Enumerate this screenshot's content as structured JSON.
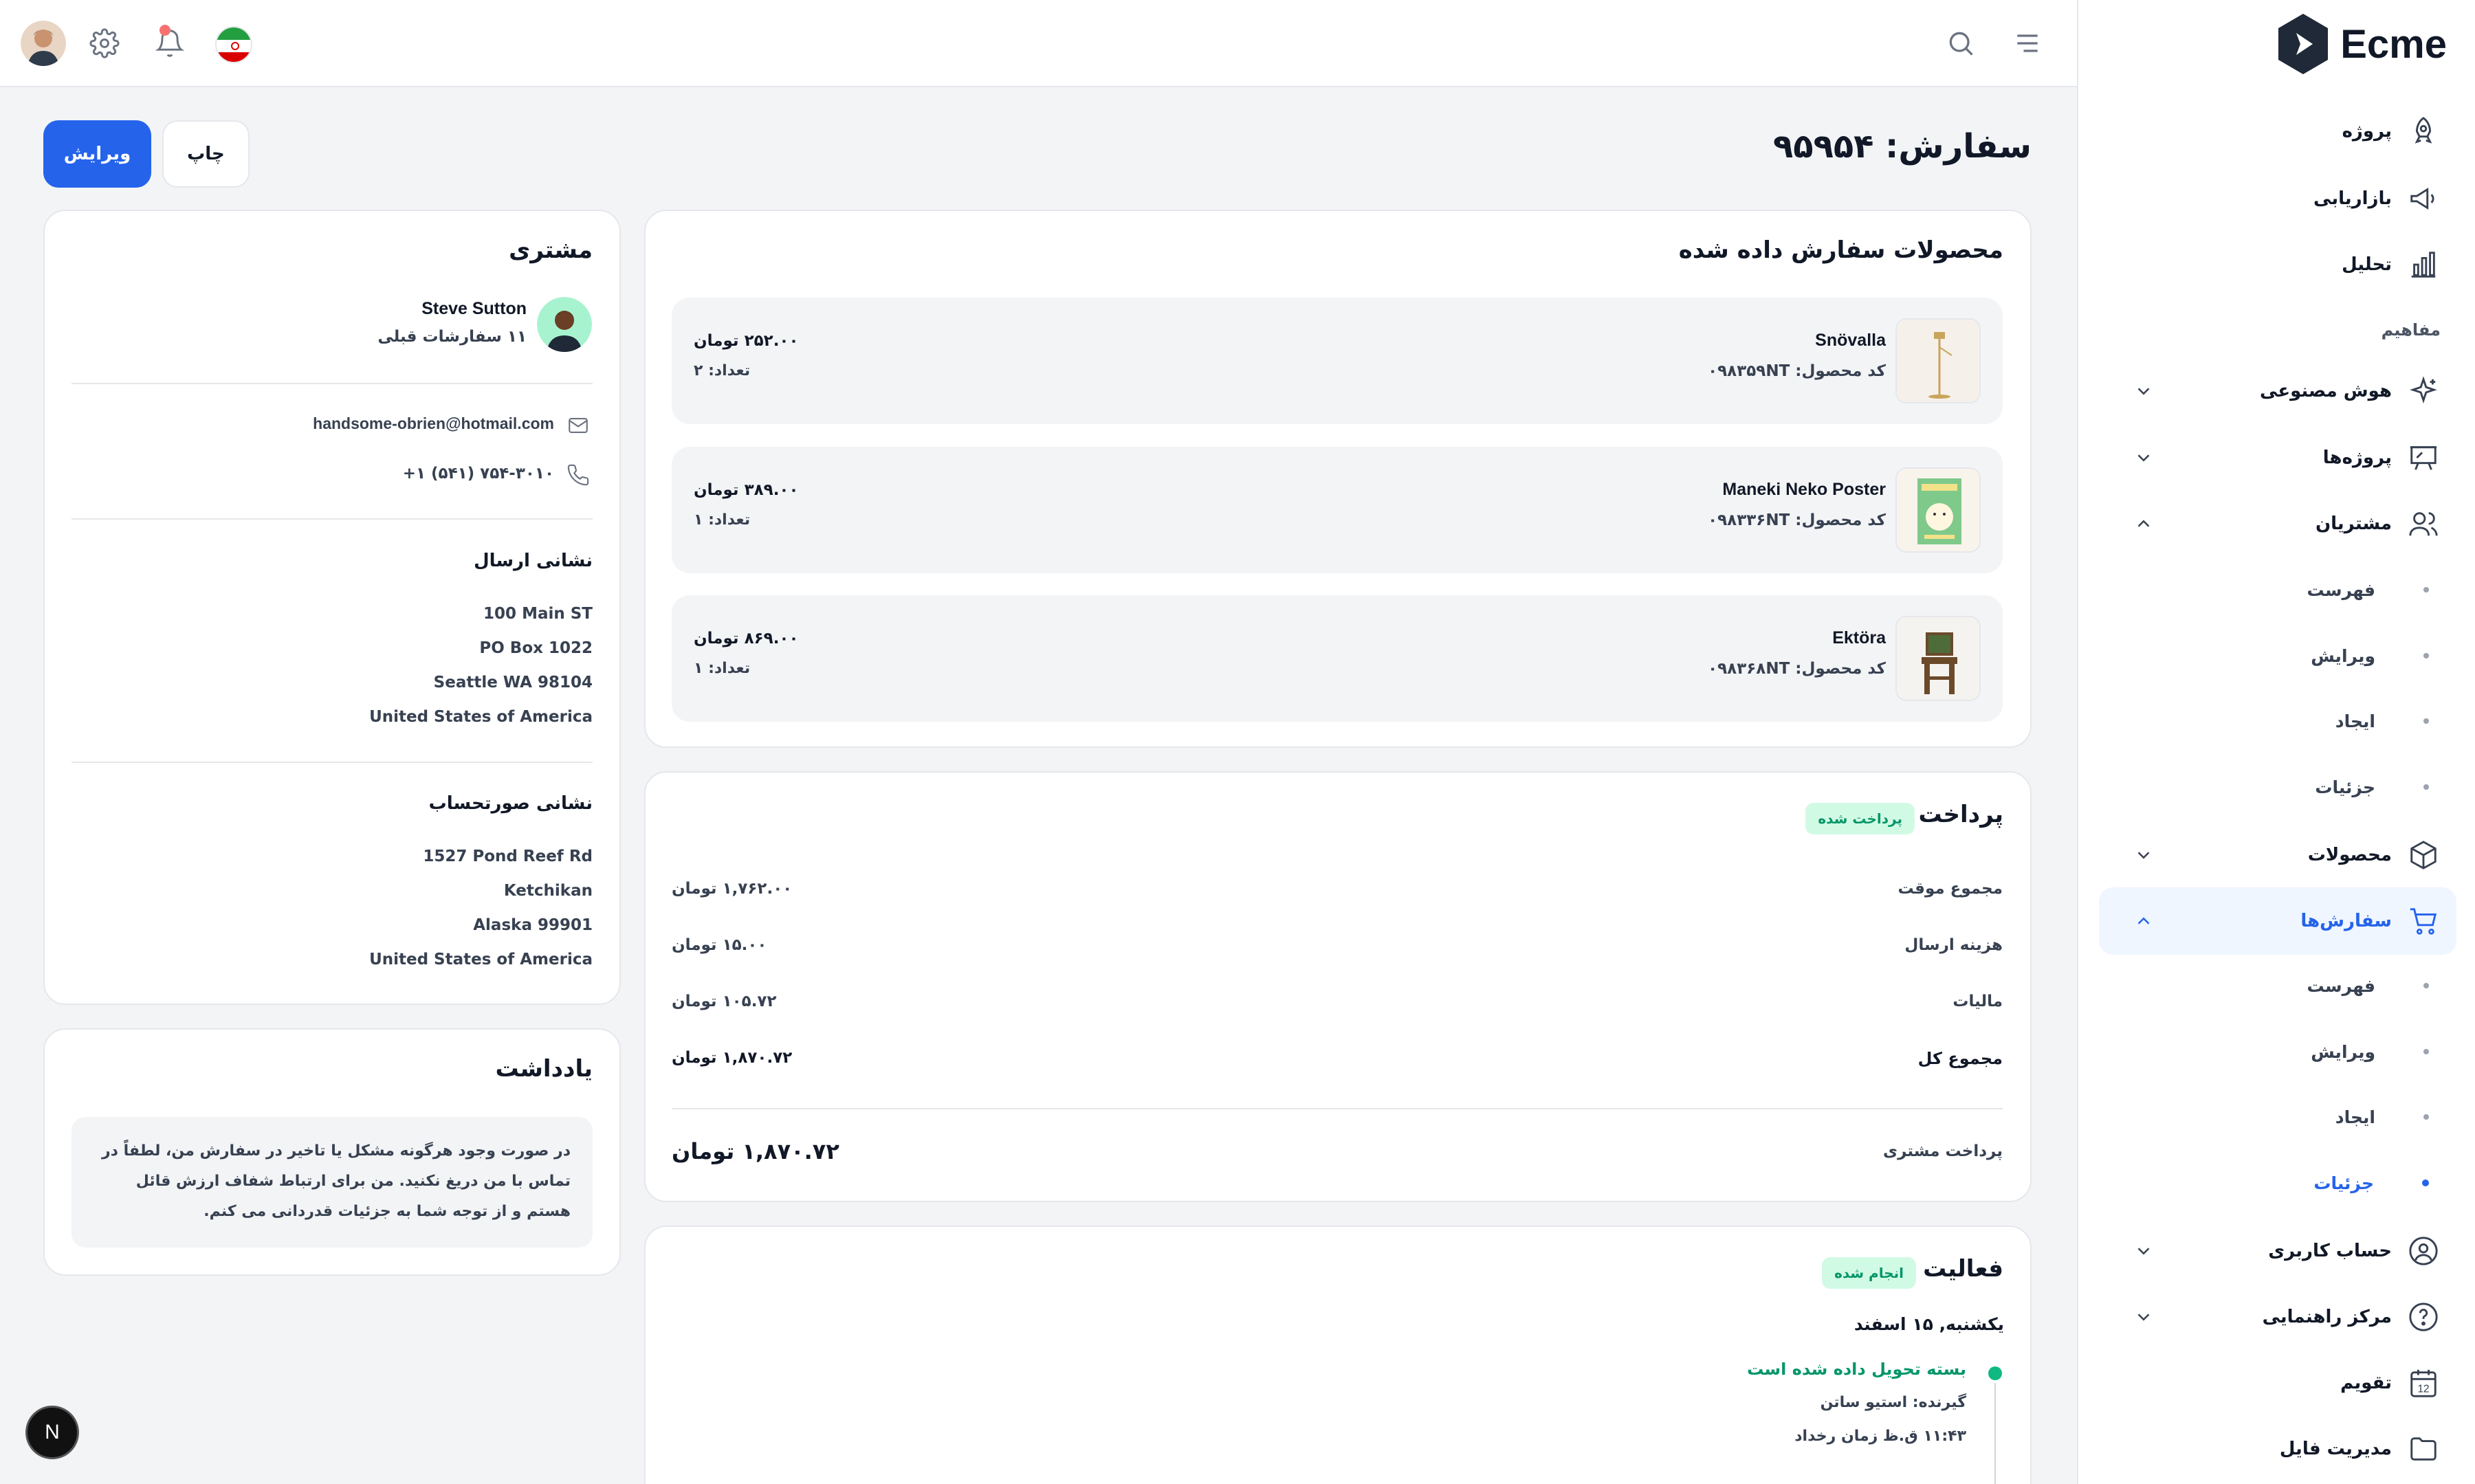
{
  "app": {
    "name": "Ecme"
  },
  "sidebar": {
    "items": [
      {
        "label": "پروژه",
        "icon": "rocket-icon"
      },
      {
        "label": "بازاریابی",
        "icon": "megaphone-icon"
      },
      {
        "label": "تحلیل",
        "icon": "chart-icon"
      }
    ],
    "section_title": "مفاهیم",
    "groups": [
      {
        "label": "هوش مصنوعی",
        "icon": "sparkle-icon"
      },
      {
        "label": "پروژه‌ها",
        "icon": "presentation-icon"
      },
      {
        "label": "مشتریان",
        "icon": "users-icon",
        "subitems": [
          "فهرست",
          "ویرایش",
          "ایجاد",
          "جزئیات"
        ]
      },
      {
        "label": "محصولات",
        "icon": "box-icon"
      },
      {
        "label": "سفارش‌ها",
        "icon": "cart-icon",
        "subitems": [
          "فهرست",
          "ویرایش",
          "ایجاد",
          "جزئیات"
        ]
      },
      {
        "label": "حساب کاربری",
        "icon": "user-circle-icon"
      },
      {
        "label": "مرکز راهنمایی",
        "icon": "help-icon"
      },
      {
        "label": "تقویم",
        "icon": "calendar-icon",
        "calendar_day": "12"
      },
      {
        "label": "مدیریت فایل",
        "icon": "folder-icon"
      }
    ]
  },
  "order": {
    "title": "سفارش: ۹۵۹۵۴",
    "edit_label": "ویرایش",
    "print_label": "چاپ"
  },
  "products": {
    "title": "محصولات سفارش داده شده",
    "items": [
      {
        "name": "Snövalla",
        "code": "کد محصول: ۰۹۸۳۵۹NT",
        "price": "۲۵۲.۰۰ تومان",
        "qty": "تعداد: ۲"
      },
      {
        "name": "Maneki Neko Poster",
        "code": "کد محصول: ۰۹۸۳۳۶NT",
        "price": "۳۸۹.۰۰ تومان",
        "qty": "تعداد: ۱"
      },
      {
        "name": "Ektöra",
        "code": "کد محصول: ۰۹۸۳۶۸NT",
        "price": "۸۶۹.۰۰ تومان",
        "qty": "تعداد: ۱"
      }
    ]
  },
  "payment": {
    "title": "پرداخت",
    "status": "پرداخت شده",
    "rows": [
      {
        "label": "مجموع موقت",
        "value": "۱,۷۶۲.۰۰ تومان"
      },
      {
        "label": "هزینه ارسال",
        "value": "۱۵.۰۰ تومان"
      },
      {
        "label": "مالیات",
        "value": "۱۰۵.۷۲ تومان"
      },
      {
        "label": "مجموع کل",
        "value": "۱,۸۷۰.۷۲ تومان"
      }
    ],
    "customer_paid_label": "پرداخت مشتری",
    "customer_paid_value": "۱,۸۷۰.۷۲ تومان"
  },
  "activity": {
    "title": "فعالیت",
    "status": "انجام شده",
    "date": "یکشنبه, ۱۵ اسفند",
    "event_title": "بسته تحویل داده شده است",
    "event_recipient": "گیرنده: استیو ساتن",
    "event_time": "۱۱:۴۳ ق.ظ زمان رخداد"
  },
  "customer": {
    "title": "مشتری",
    "name": "Steve Sutton",
    "orders": "۱۱ سفارشات قبلی",
    "email": "handsome-obrien@hotmail.com",
    "phone": "+۱ (۵۴۱) ۷۵۴-۳۰۱۰",
    "shipping_title": "نشانی ارسال",
    "shipping": [
      "100 Main ST",
      "PO Box 1022",
      "Seattle WA 98104",
      "United States of America"
    ],
    "billing_title": "نشانی صورتحساب",
    "billing": [
      "1527 Pond Reef Rd",
      "Ketchikan",
      "Alaska 99901",
      "United States of America"
    ]
  },
  "note": {
    "title": "یادداشت",
    "text": "در صورت وجود هرگونه مشکل یا تاخیر در سفارش من، لطفاً در تماس با من دریغ نکنید. من برای ارتباط شفاف ارزش قائل هستم و از توجه شما به جزئیات قدردانی می کنم."
  },
  "fab": {
    "label": "N"
  },
  "colors": {
    "primary": "#2563eb",
    "success": "#059669",
    "success_bg": "#d1fae5"
  }
}
